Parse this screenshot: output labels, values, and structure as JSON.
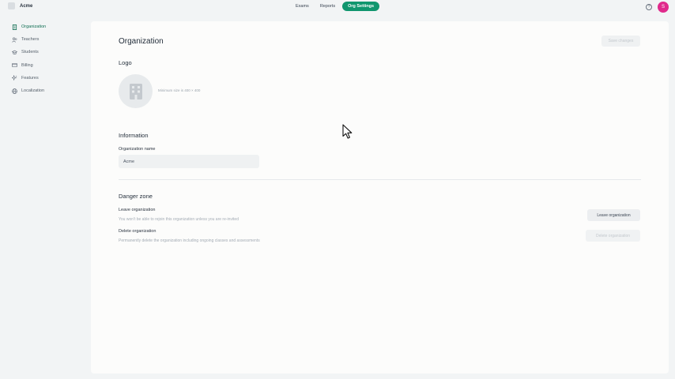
{
  "topbar": {
    "org_name": "Acme",
    "tabs": [
      {
        "label": "Exams"
      },
      {
        "label": "Reports"
      },
      {
        "label": "Org Settings",
        "active": true
      }
    ],
    "avatar_initial": "S",
    "help_icon": "?"
  },
  "sidebar": {
    "items": [
      {
        "label": "Organization",
        "icon": "building-icon",
        "active": true
      },
      {
        "label": "Teachers",
        "icon": "users-icon"
      },
      {
        "label": "Students",
        "icon": "graduation-cap-icon"
      },
      {
        "label": "Billing",
        "icon": "credit-card-icon"
      },
      {
        "label": "Features",
        "icon": "sparkles-icon"
      },
      {
        "label": "Localization",
        "icon": "globe-icon"
      }
    ]
  },
  "main": {
    "title": "Organization",
    "save_label": "Save changes",
    "logo": {
      "heading": "Logo",
      "hint": "Minimum size is 400 × 400"
    },
    "information": {
      "heading": "Information",
      "org_name_label": "Organization name",
      "org_name_value": "Acme"
    },
    "danger_zone": {
      "heading": "Danger zone",
      "leave": {
        "title": "Leave organization",
        "description": "You won't be able to rejoin this organization unless you are re-invited",
        "button": "Leave organization"
      },
      "delete": {
        "title": "Delete organization",
        "description": "Permanently delete the organization including ongoing classes and assessments",
        "button": "Delete organization"
      }
    }
  },
  "colors": {
    "accent": "#10966e",
    "avatar": "#e02a8b",
    "background": "#f2f4f5",
    "panel": "#fcfcfb"
  }
}
